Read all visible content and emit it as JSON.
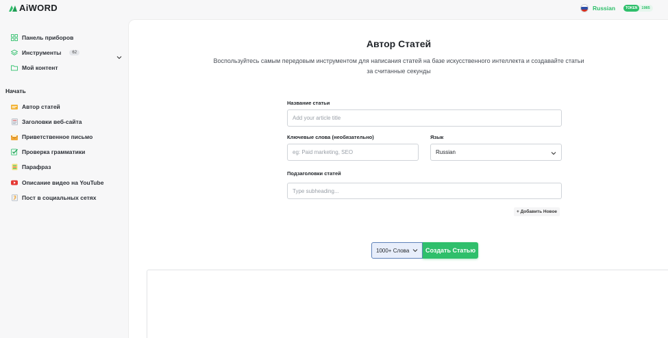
{
  "app": {
    "logo_text": "AiWORD",
    "language": "Russian",
    "token_label": "TOKEN",
    "token_count": "1985"
  },
  "sidebar": {
    "top_items": [
      {
        "label": "Панель приборов",
        "icon": "dashboard-grid-icon"
      },
      {
        "label": "Инструменты",
        "icon": "layers-icon",
        "badge": "62"
      },
      {
        "label": "Мой контент",
        "icon": "folder-icon"
      }
    ],
    "section_title": "Начать",
    "tools": [
      {
        "label": "Автор статей",
        "icon": "article-icon"
      },
      {
        "label": "Заголовки веб-сайта",
        "icon": "headline-icon"
      },
      {
        "label": "Приветственное письмо",
        "icon": "envelope-icon"
      },
      {
        "label": "Проверка грамматики",
        "icon": "grammar-check-icon"
      },
      {
        "label": "Парафраз",
        "icon": "paraphrase-icon"
      },
      {
        "label": "Описание видео на YouTube",
        "icon": "youtube-icon"
      },
      {
        "label": "Пост в социальных сетях",
        "icon": "social-post-icon"
      }
    ]
  },
  "main": {
    "title": "Автор Статей",
    "subtitle": "Воспользуйтесь самым передовым инструментом для написания статей на базе искусственного интеллекта и создавайте статьи за считанные секунды",
    "article_title_label": "Название статьи",
    "article_title_placeholder": "Add your article title",
    "keywords_label": "Ключевые слова (необязательно)",
    "keywords_placeholder": "eg: Paid marketing, SEO",
    "language_label": "Язык",
    "language_value": "Russian",
    "subheadings_label": "Подзаголовки статей",
    "subheadings_placeholder": "Type subheading...",
    "add_new_label": "+ Добавить Новое",
    "word_count_value": "1000+ Слова",
    "create_button_label": "Создать Статью"
  },
  "colors": {
    "accent": "#2fbf6b",
    "word_select_border": "#5b7fb8"
  }
}
